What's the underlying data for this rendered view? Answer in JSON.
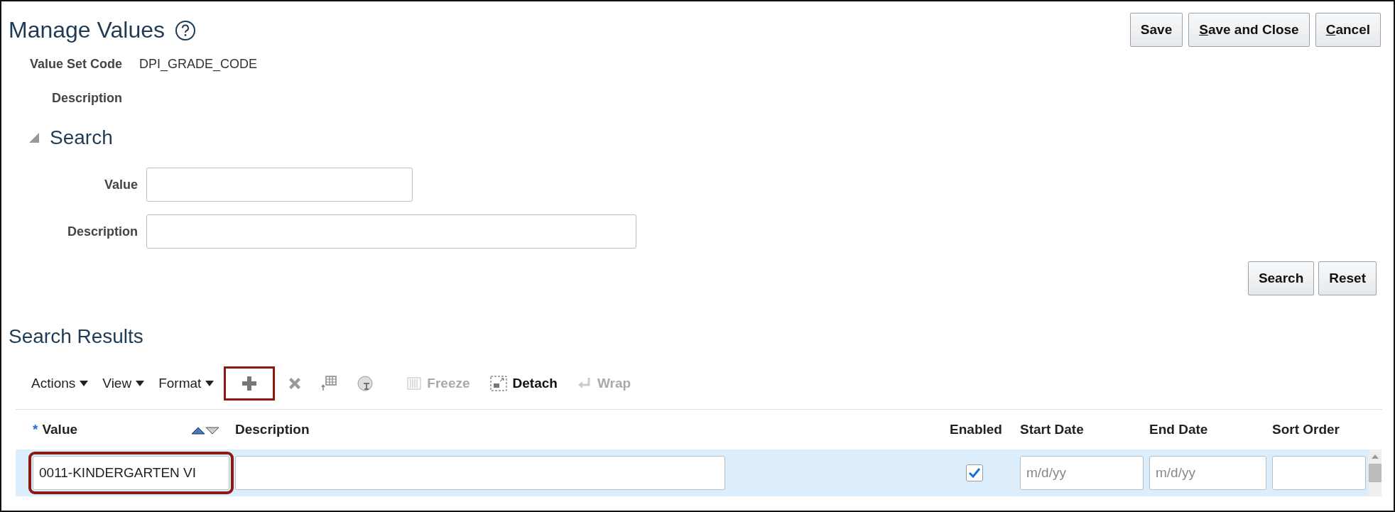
{
  "page": {
    "title": "Manage Values"
  },
  "header_buttons": [
    {
      "label": "Save",
      "underline_first": false
    },
    {
      "label": "Save and Close",
      "underline_first": true
    },
    {
      "label": "Cancel",
      "underline_first": true
    }
  ],
  "fields": [
    {
      "label": "Value Set Code",
      "value": "DPI_GRADE_CODE"
    },
    {
      "label": "Description"
    }
  ],
  "search": {
    "title": "Search",
    "expanded": true,
    "fields": [
      {
        "label": "Value"
      },
      {
        "label": "Description"
      }
    ],
    "buttons": [
      "Search",
      "Reset"
    ]
  },
  "results": {
    "title": "Search Results",
    "toolbar": [
      {
        "kind": "menu",
        "label": "Actions"
      },
      {
        "kind": "menu",
        "label": "View"
      },
      {
        "kind": "menu",
        "label": "Format"
      },
      {
        "kind": "icon",
        "disabled": false,
        "highlighted": true
      },
      {
        "kind": "icon",
        "disabled": false,
        "highlighted": false
      },
      {
        "kind": "icon",
        "disabled": false,
        "highlighted": false
      },
      {
        "kind": "icon",
        "disabled": false,
        "highlighted": false
      },
      {
        "kind": "text",
        "label": "Freeze",
        "disabled": true
      },
      {
        "kind": "text",
        "label": "Detach",
        "disabled": false
      },
      {
        "kind": "text",
        "label": "Wrap",
        "disabled": true
      }
    ],
    "columns": [
      {
        "label": "Value",
        "marker": "*",
        "sortable": true
      },
      {
        "label": "Description",
        "sortable": false
      },
      {
        "label": "Enabled",
        "sortable": false
      },
      {
        "label": "Start Date",
        "sortable": false
      },
      {
        "label": "End Date",
        "sortable": false
      },
      {
        "label": "Sort Order",
        "sortable": false
      }
    ],
    "rows": [
      {
        "selected": true,
        "value": "0011-KINDERGARTEN VI",
        "value_highlighted": true,
        "enabled": true,
        "start_date_placeholder": "m/d/yy",
        "end_date_placeholder": "m/d/yy"
      }
    ]
  }
}
